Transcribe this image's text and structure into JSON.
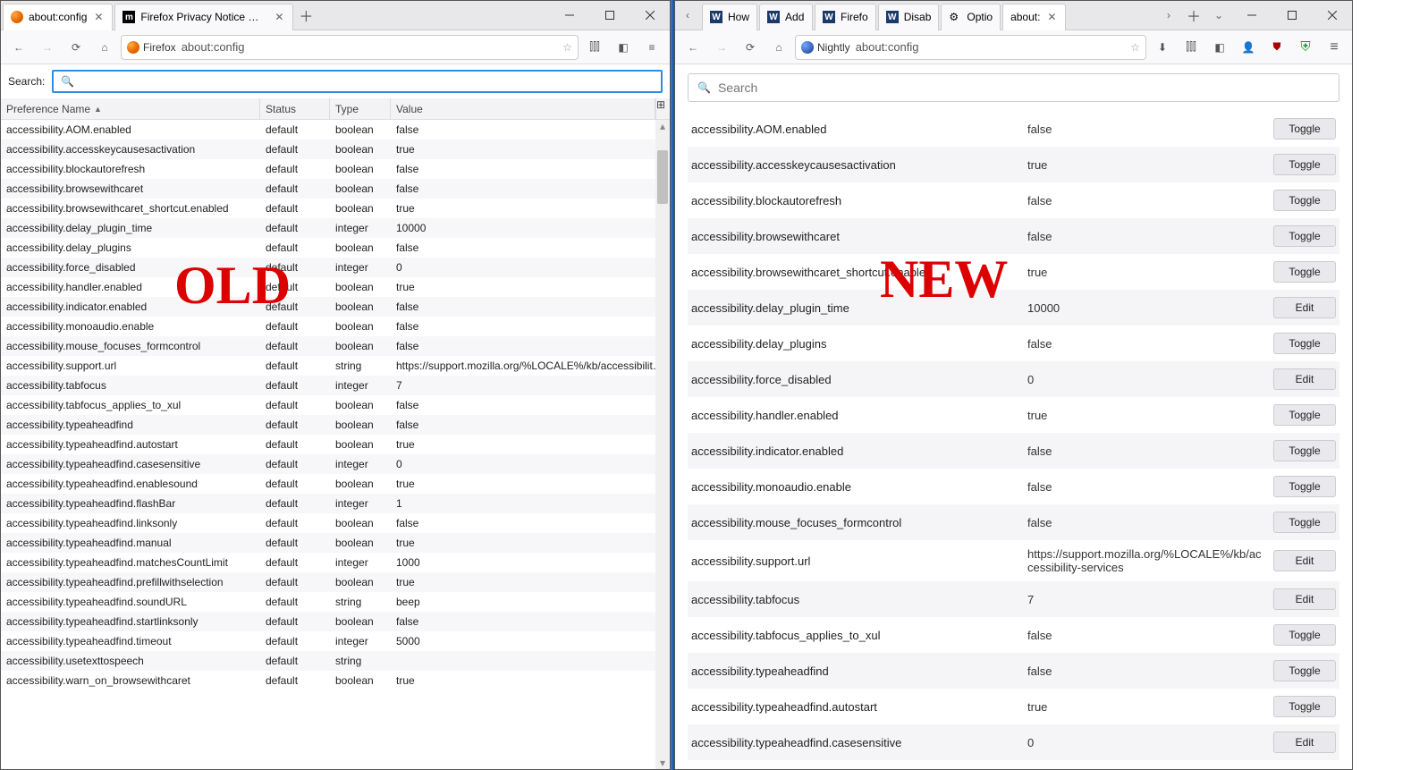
{
  "left": {
    "tabs": [
      {
        "title": "about:config",
        "favicon": "firefox",
        "active": true
      },
      {
        "title": "Firefox Privacy Notice — Mozilla",
        "favicon": "mozilla",
        "active": false
      }
    ],
    "url_identity": "Firefox",
    "url": "about:config",
    "search_label": "Search:",
    "headers": {
      "name": "Preference Name",
      "status": "Status",
      "type": "Type",
      "value": "Value"
    },
    "rows": [
      {
        "name": "accessibility.AOM.enabled",
        "status": "default",
        "type": "boolean",
        "value": "false"
      },
      {
        "name": "accessibility.accesskeycausesactivation",
        "status": "default",
        "type": "boolean",
        "value": "true"
      },
      {
        "name": "accessibility.blockautorefresh",
        "status": "default",
        "type": "boolean",
        "value": "false"
      },
      {
        "name": "accessibility.browsewithcaret",
        "status": "default",
        "type": "boolean",
        "value": "false"
      },
      {
        "name": "accessibility.browsewithcaret_shortcut.enabled",
        "status": "default",
        "type": "boolean",
        "value": "true"
      },
      {
        "name": "accessibility.delay_plugin_time",
        "status": "default",
        "type": "integer",
        "value": "10000"
      },
      {
        "name": "accessibility.delay_plugins",
        "status": "default",
        "type": "boolean",
        "value": "false"
      },
      {
        "name": "accessibility.force_disabled",
        "status": "default",
        "type": "integer",
        "value": "0"
      },
      {
        "name": "accessibility.handler.enabled",
        "status": "default",
        "type": "boolean",
        "value": "true"
      },
      {
        "name": "accessibility.indicator.enabled",
        "status": "default",
        "type": "boolean",
        "value": "false"
      },
      {
        "name": "accessibility.monoaudio.enable",
        "status": "default",
        "type": "boolean",
        "value": "false"
      },
      {
        "name": "accessibility.mouse_focuses_formcontrol",
        "status": "default",
        "type": "boolean",
        "value": "false"
      },
      {
        "name": "accessibility.support.url",
        "status": "default",
        "type": "string",
        "value": "https://support.mozilla.org/%LOCALE%/kb/accessibility..."
      },
      {
        "name": "accessibility.tabfocus",
        "status": "default",
        "type": "integer",
        "value": "7"
      },
      {
        "name": "accessibility.tabfocus_applies_to_xul",
        "status": "default",
        "type": "boolean",
        "value": "false"
      },
      {
        "name": "accessibility.typeaheadfind",
        "status": "default",
        "type": "boolean",
        "value": "false"
      },
      {
        "name": "accessibility.typeaheadfind.autostart",
        "status": "default",
        "type": "boolean",
        "value": "true"
      },
      {
        "name": "accessibility.typeaheadfind.casesensitive",
        "status": "default",
        "type": "integer",
        "value": "0"
      },
      {
        "name": "accessibility.typeaheadfind.enablesound",
        "status": "default",
        "type": "boolean",
        "value": "true"
      },
      {
        "name": "accessibility.typeaheadfind.flashBar",
        "status": "default",
        "type": "integer",
        "value": "1"
      },
      {
        "name": "accessibility.typeaheadfind.linksonly",
        "status": "default",
        "type": "boolean",
        "value": "false"
      },
      {
        "name": "accessibility.typeaheadfind.manual",
        "status": "default",
        "type": "boolean",
        "value": "true"
      },
      {
        "name": "accessibility.typeaheadfind.matchesCountLimit",
        "status": "default",
        "type": "integer",
        "value": "1000"
      },
      {
        "name": "accessibility.typeaheadfind.prefillwithselection",
        "status": "default",
        "type": "boolean",
        "value": "true"
      },
      {
        "name": "accessibility.typeaheadfind.soundURL",
        "status": "default",
        "type": "string",
        "value": "beep"
      },
      {
        "name": "accessibility.typeaheadfind.startlinksonly",
        "status": "default",
        "type": "boolean",
        "value": "false"
      },
      {
        "name": "accessibility.typeaheadfind.timeout",
        "status": "default",
        "type": "integer",
        "value": "5000"
      },
      {
        "name": "accessibility.usetexttospeech",
        "status": "default",
        "type": "string",
        "value": ""
      },
      {
        "name": "accessibility.warn_on_browsewithcaret",
        "status": "default",
        "type": "boolean",
        "value": "true"
      }
    ]
  },
  "right": {
    "tabs_pre": [
      {
        "title": "How",
        "favicon": "wa"
      },
      {
        "title": "Add",
        "favicon": "wa"
      },
      {
        "title": "Firefo",
        "favicon": "wa"
      },
      {
        "title": "Disab",
        "favicon": "wa"
      },
      {
        "title": "Optio",
        "favicon": "gear"
      }
    ],
    "active_tab": {
      "title": "about:"
    },
    "url_identity": "Nightly",
    "url": "about:config",
    "search_placeholder": "Search",
    "rows": [
      {
        "key": "accessibility.AOM.enabled",
        "val": "false",
        "btn": "Toggle"
      },
      {
        "key": "accessibility.accesskeycausesactivation",
        "val": "true",
        "btn": "Toggle"
      },
      {
        "key": "accessibility.blockautorefresh",
        "val": "false",
        "btn": "Toggle"
      },
      {
        "key": "accessibility.browsewithcaret",
        "val": "false",
        "btn": "Toggle"
      },
      {
        "key": "accessibility.browsewithcaret_shortcut.enabled",
        "val": "true",
        "btn": "Toggle"
      },
      {
        "key": "accessibility.delay_plugin_time",
        "val": "10000",
        "btn": "Edit"
      },
      {
        "key": "accessibility.delay_plugins",
        "val": "false",
        "btn": "Toggle"
      },
      {
        "key": "accessibility.force_disabled",
        "val": "0",
        "btn": "Edit"
      },
      {
        "key": "accessibility.handler.enabled",
        "val": "true",
        "btn": "Toggle"
      },
      {
        "key": "accessibility.indicator.enabled",
        "val": "false",
        "btn": "Toggle"
      },
      {
        "key": "accessibility.monoaudio.enable",
        "val": "false",
        "btn": "Toggle"
      },
      {
        "key": "accessibility.mouse_focuses_formcontrol",
        "val": "false",
        "btn": "Toggle"
      },
      {
        "key": "accessibility.support.url",
        "val": "https://support.mozilla.org/%LOCALE%/kb/accessibility-services",
        "btn": "Edit"
      },
      {
        "key": "accessibility.tabfocus",
        "val": "7",
        "btn": "Edit"
      },
      {
        "key": "accessibility.tabfocus_applies_to_xul",
        "val": "false",
        "btn": "Toggle"
      },
      {
        "key": "accessibility.typeaheadfind",
        "val": "false",
        "btn": "Toggle"
      },
      {
        "key": "accessibility.typeaheadfind.autostart",
        "val": "true",
        "btn": "Toggle"
      },
      {
        "key": "accessibility.typeaheadfind.casesensitive",
        "val": "0",
        "btn": "Edit"
      }
    ]
  },
  "overlay": {
    "old": "OLD",
    "new": "NEW"
  }
}
